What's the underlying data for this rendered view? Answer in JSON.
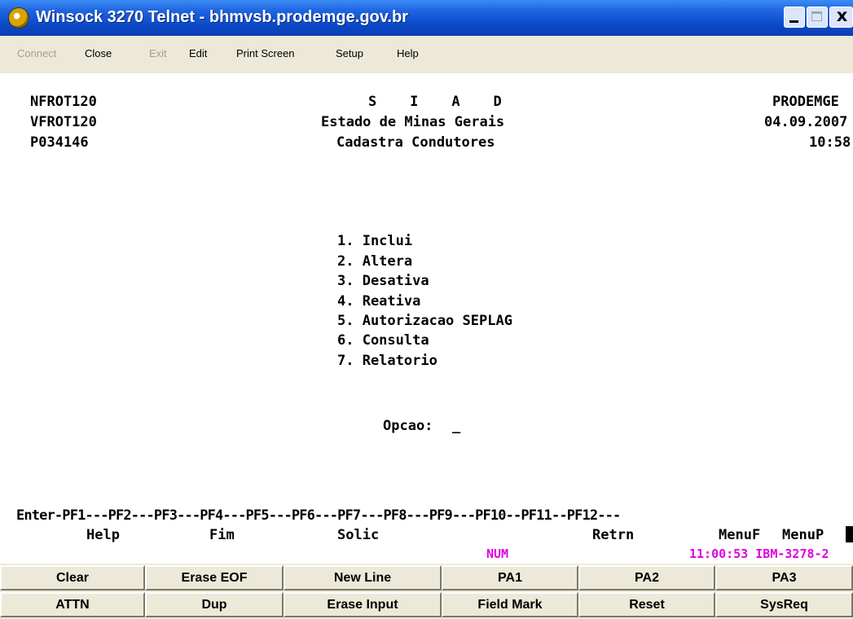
{
  "window": {
    "title": "Winsock 3270 Telnet - bhmvsb.prodemge.gov.br",
    "close_glyph": "x"
  },
  "menu": [
    {
      "label": "Connect",
      "enabled": false
    },
    {
      "label": "Close",
      "enabled": true
    },
    {
      "label": "Exit",
      "enabled": false
    },
    {
      "label": "Edit",
      "enabled": true
    },
    {
      "label": "Print Screen",
      "enabled": true
    },
    {
      "label": "Setup",
      "enabled": true
    },
    {
      "label": "Help",
      "enabled": true
    }
  ],
  "screen": {
    "header": {
      "left": [
        "NFROT120",
        "VFROT120",
        "P034146"
      ],
      "center": [
        "S    I    A    D",
        "Estado de Minas Gerais",
        "Cadastra Condutores"
      ],
      "right": [
        "PRODEMGE",
        "04.09.2007",
        "10:58"
      ]
    },
    "options": [
      "1. Inclui",
      "2. Altera",
      "3. Desativa",
      "4. Reativa",
      "5. Autorizacao SEPLAG",
      "6. Consulta",
      "7. Relatorio"
    ],
    "prompt_label": "Opcao:",
    "input_value": "_",
    "pf_keys_line": "Enter-PF1---PF2---PF3---PF4---PF5---PF6---PF7---PF8---PF9---PF10--PF11--PF12---",
    "pf_labels": {
      "pf1": "Help",
      "pf3": "Fim",
      "pf5": "Solic",
      "pf9": "Retrn",
      "pf11": "MenuF",
      "pf12": "MenuP"
    },
    "status": {
      "num": "NUM",
      "time_term": "11:00:53 IBM-3278-2",
      "color": "#e000e0"
    }
  },
  "buttons": {
    "row1": [
      "Clear",
      "Erase EOF",
      "New Line",
      "PA1",
      "PA2",
      "PA3"
    ],
    "row2": [
      "ATTN",
      "Dup",
      "Erase Input",
      "Field Mark",
      "Reset",
      "SysReq"
    ]
  }
}
